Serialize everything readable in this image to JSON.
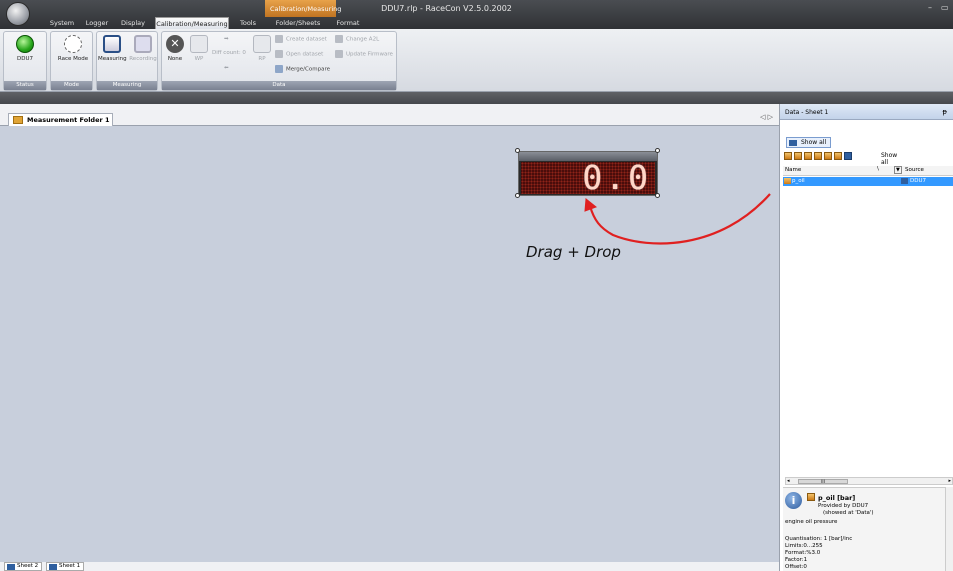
{
  "window": {
    "title": "DDU7.rlp - RaceCon V2.5.0.2002",
    "context_tab": "Calibration/Measuring",
    "minimize": "–",
    "restore": "▭"
  },
  "tabs": [
    "System",
    "Logger",
    "Display",
    "Calibration/Measuring",
    "Tools",
    "Folder/Sheets",
    "Format"
  ],
  "ribbon": {
    "status_group": "Status",
    "status_btn": "DDU7",
    "mode_group": "Mode",
    "race_mode": "Race Mode",
    "measuring_group": "Measuring",
    "measuring": "Measuring",
    "recording": "Recording",
    "data_group": "Data",
    "none": "None",
    "wp": "WP",
    "rp": "RP",
    "diff_count": "Diff count: 0",
    "create_dataset": "Create dataset",
    "open_dataset": "Open dataset",
    "merge_compare": "Merge/Compare",
    "change_a2l": "Change A2L",
    "update_firmware": "Update Firmware"
  },
  "workarea": {
    "folder_tab": "Measurement Folder 1",
    "nav_arrows": "◁ ▷",
    "display_value": "0.0",
    "drag_label": "Drag + Drop",
    "sheet_tabs": [
      "Sheet 2",
      "Sheet 1"
    ]
  },
  "panel": {
    "title": "Data - Sheet 1",
    "pin": "ᵽ",
    "show_all_btn": "Show all",
    "toolbar_show_all": "Show all",
    "columns": {
      "name": "Name",
      "sort": "\\",
      "filter": "▼",
      "source": "Source"
    },
    "rows": [
      {
        "name": "p_oil",
        "source": "DDU7"
      }
    ],
    "scroll_thumb": "III",
    "info": {
      "title": "p_oil [bar]",
      "provided_by": "Provided by DDU7",
      "shown_at": "(showed at 'Data')",
      "description": "engine oil pressure",
      "quantisation": "Quantisation: 1 [bar]/inc",
      "limits": "Limits:0...255",
      "format": "Format:%3.0",
      "factor": "Factor:1",
      "offset": "Offset:0"
    }
  },
  "colors": {
    "accent_orange": "#e8a24a",
    "selection_blue": "#3399ff",
    "arrow_red": "#e02020",
    "led_background": "#4a0d0b"
  }
}
